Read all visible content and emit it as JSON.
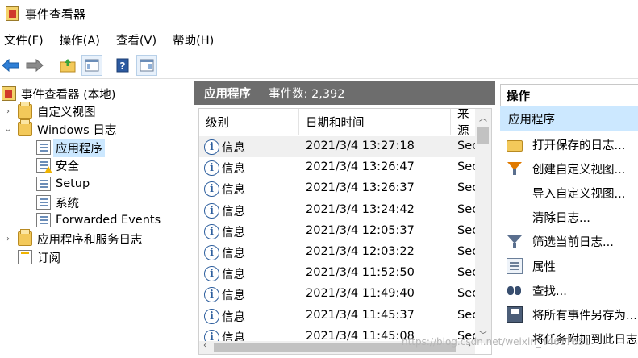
{
  "window": {
    "title": "事件查看器"
  },
  "menu": [
    {
      "label": "文件(F)"
    },
    {
      "label": "操作(A)"
    },
    {
      "label": "查看(V)"
    },
    {
      "label": "帮助(H)"
    }
  ],
  "tree": {
    "root": "事件查看器 (本地)",
    "items": [
      {
        "label": "自定义视图"
      },
      {
        "label": "Windows 日志"
      },
      {
        "label": "应用程序"
      },
      {
        "label": "安全"
      },
      {
        "label": "Setup"
      },
      {
        "label": "系统"
      },
      {
        "label": "Forwarded Events"
      },
      {
        "label": "应用程序和服务日志"
      },
      {
        "label": "订阅"
      }
    ]
  },
  "main": {
    "title": "应用程序",
    "count": "事件数: 2,392",
    "columns": [
      "级别",
      "日期和时间",
      "来源"
    ],
    "rows": [
      {
        "level": "信息",
        "datetime": "2021/3/4 13:27:18",
        "source": "Sec"
      },
      {
        "level": "信息",
        "datetime": "2021/3/4 13:26:47",
        "source": "Sec"
      },
      {
        "level": "信息",
        "datetime": "2021/3/4 13:26:37",
        "source": "Sec"
      },
      {
        "level": "信息",
        "datetime": "2021/3/4 13:24:42",
        "source": "Sec"
      },
      {
        "level": "信息",
        "datetime": "2021/3/4 12:05:37",
        "source": "Sec"
      },
      {
        "level": "信息",
        "datetime": "2021/3/4 12:03:22",
        "source": "Sec"
      },
      {
        "level": "信息",
        "datetime": "2021/3/4 11:52:50",
        "source": "Sec"
      },
      {
        "level": "信息",
        "datetime": "2021/3/4 11:49:40",
        "source": "Sec"
      },
      {
        "level": "信息",
        "datetime": "2021/3/4 11:45:37",
        "source": "Sec"
      },
      {
        "level": "信息",
        "datetime": "2021/3/4 11:45:08",
        "source": "Sec"
      }
    ]
  },
  "actions": {
    "header": "操作",
    "section": "应用程序",
    "items": [
      {
        "label": "打开保存的日志...",
        "icon": "folder-open-icon"
      },
      {
        "label": "创建自定义视图...",
        "icon": "filter-create-icon"
      },
      {
        "label": "导入自定义视图...",
        "icon": ""
      },
      {
        "label": "清除日志...",
        "icon": ""
      },
      {
        "label": "筛选当前日志...",
        "icon": "filter-icon"
      },
      {
        "label": "属性",
        "icon": "properties-icon"
      },
      {
        "label": "查找...",
        "icon": "binoculars-icon"
      },
      {
        "label": "将所有事件另存为...",
        "icon": "save-icon"
      },
      {
        "label": "将任务附加到此日志",
        "icon": ""
      }
    ]
  },
  "watermark": "https://blog.csdn.net/weixin_44617651"
}
